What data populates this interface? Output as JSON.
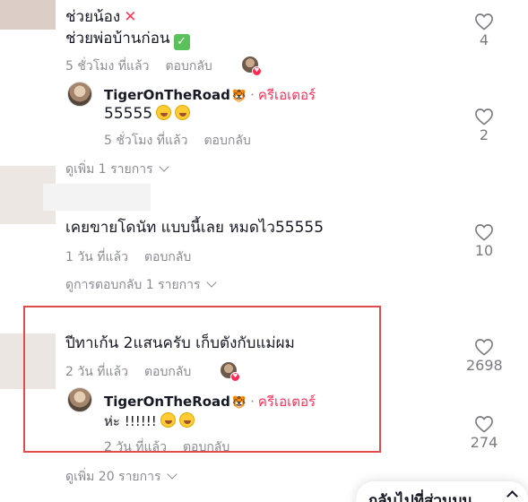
{
  "comments": [
    {
      "line1": "ช่วยน้อง",
      "line2": "ช่วยพ่อบ้านก่อน",
      "time": "5 ชั่วโมง ที่แล้ว",
      "reply_label": "ตอบกลับ",
      "likes": "4",
      "reply": {
        "author": "TigerOnTheRoad",
        "creator_label": "ครีเอเตอร์",
        "text": "55555",
        "time": "5 ชั่วโมง ที่แล้ว",
        "reply_label": "ตอบกลับ",
        "likes": "2"
      },
      "more": "ดูเพิ่ม 1 รายการ"
    },
    {
      "text": "เคยขายโดนัท แบบนี้เลย หมดไว55555",
      "time": "1 วัน ที่แล้ว",
      "reply_label": "ตอบกลับ",
      "likes": "10",
      "more": "ดูการตอบกลับ 1 รายการ"
    },
    {
      "text": "ปีทาเก้น 2แสนครับ เก็บตังกับแม่ผม",
      "time": "2 วัน ที่แล้ว",
      "reply_label": "ตอบกลับ",
      "likes": "2698",
      "reply": {
        "author": "TigerOnTheRoad",
        "creator_label": "ครีเอเตอร์",
        "text": "ห่ะ !!!!!!",
        "time": "2 วัน ที่แล้ว",
        "reply_label": "ตอบกลับ",
        "likes": "274"
      },
      "more": "ดูเพิ่ม 20 รายการ"
    }
  ],
  "back_to_top": "กลับไปที่ส่วนบน",
  "colors": {
    "creator": "#fe2c55",
    "highlight": "#e04b4b"
  }
}
